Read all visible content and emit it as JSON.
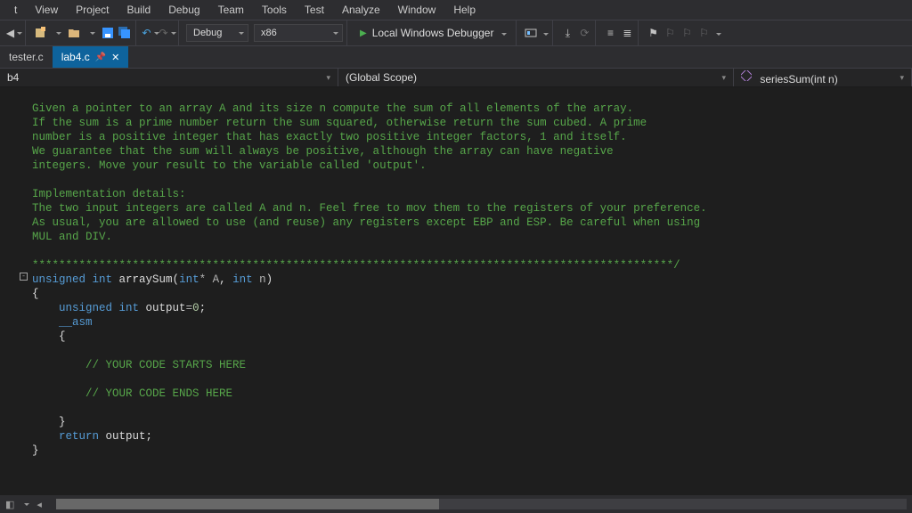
{
  "menu": [
    "View",
    "Project",
    "Build",
    "Debug",
    "Team",
    "Tools",
    "Test",
    "Analyze",
    "Window",
    "Help"
  ],
  "toolbar": {
    "config": "Debug",
    "platform": "x86",
    "run": "Local Windows Debugger"
  },
  "tabs": {
    "inactive": "tester.c",
    "active": "lab4.c"
  },
  "context": {
    "left": "b4",
    "mid": "(Global Scope)",
    "right": "seriesSum(int n)"
  },
  "code": {
    "c1": "Given a pointer to an array A and its size n compute the sum of all elements of the array.",
    "c2": "If the sum is a prime number return the sum squared, otherwise return the sum cubed. A prime",
    "c3": "number is a positive integer that has exactly two positive integer factors, 1 and itself.",
    "c4": "We guarantee that the sum will always be positive, although the array can have negative",
    "c5": "integers. Move your result to the variable called 'output'.",
    "c6": "",
    "c7": "Implementation details:",
    "c8": "The two input integers are called A and n. Feel free to mov them to the registers of your preference.",
    "c9": "As usual, you are allowed to use (and reuse) any registers except EBP and ESP. Be careful when using",
    "c10": "MUL and DIV.",
    "c11": "",
    "sep": "************************************************************************************************/",
    "sig_u": "unsigned",
    "sig_int": " int",
    "sig_name": " arraySum",
    "sig_open": "(",
    "sig_p1t": "int",
    "sig_p1s": "*",
    "sig_p1n": " A",
    "sig_comma": ", ",
    "sig_p2t": "int",
    "sig_p2n": " n",
    "sig_close": ")",
    "ob": "{",
    "d_u": "unsigned",
    "d_int": " int",
    "d_name": " output",
    "d_eq": "=",
    "d_zero": "0",
    "d_semi": ";",
    "asm": "__asm",
    "ob2": "{",
    "cm_start": "// YOUR CODE STARTS HERE",
    "cm_end": "// YOUR CODE ENDS HERE",
    "cb2": "}",
    "ret_kw": "return",
    "ret_id": " output",
    "ret_semi": ";",
    "cb": "}"
  },
  "bottom": {
    "left_label": ""
  }
}
